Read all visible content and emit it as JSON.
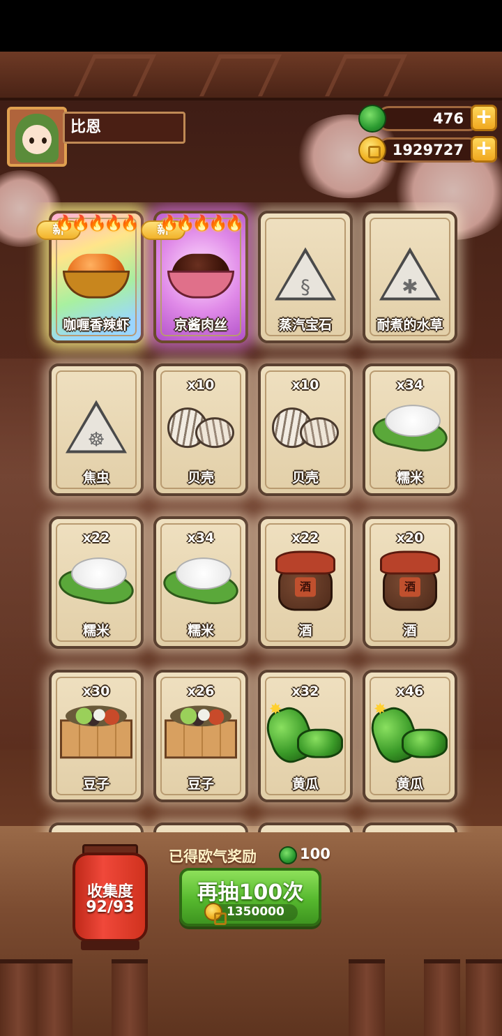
{
  "player": {
    "name": "比恩"
  },
  "resources": {
    "jade": "476",
    "coins": "1929727",
    "plus": "+"
  },
  "badge_new": "新",
  "cards": [
    {
      "label": "咖喱香辣虾",
      "count": "",
      "art": "dish-curry",
      "new": true,
      "rarity": "rainbow",
      "flames": "🔥🔥🔥🔥🔥"
    },
    {
      "label": "京酱肉丝",
      "count": "",
      "art": "dish-pork",
      "new": true,
      "rarity": "purple",
      "flames": "🔥🔥🔥🔥🔥"
    },
    {
      "label": "蒸汽宝石",
      "count": "",
      "art": "stone-steam",
      "new": false,
      "rarity": "normal"
    },
    {
      "label": "耐煮的水草",
      "count": "",
      "art": "stone-weed",
      "new": false,
      "rarity": "normal"
    },
    {
      "label": "焦虫",
      "count": "",
      "art": "stone-bug",
      "new": false,
      "rarity": "normal"
    },
    {
      "label": "贝壳",
      "count": "x10",
      "art": "shell",
      "new": false,
      "rarity": "normal"
    },
    {
      "label": "贝壳",
      "count": "x10",
      "art": "shell",
      "new": false,
      "rarity": "normal"
    },
    {
      "label": "糯米",
      "count": "x34",
      "art": "rice",
      "new": false,
      "rarity": "normal"
    },
    {
      "label": "糯米",
      "count": "x22",
      "art": "rice",
      "new": false,
      "rarity": "normal"
    },
    {
      "label": "糯米",
      "count": "x34",
      "art": "rice",
      "new": false,
      "rarity": "normal"
    },
    {
      "label": "酒",
      "count": "x22",
      "art": "jar",
      "new": false,
      "rarity": "normal"
    },
    {
      "label": "酒",
      "count": "x20",
      "art": "jar",
      "new": false,
      "rarity": "normal"
    },
    {
      "label": "豆子",
      "count": "x30",
      "art": "box",
      "new": false,
      "rarity": "normal"
    },
    {
      "label": "豆子",
      "count": "x26",
      "art": "box",
      "new": false,
      "rarity": "normal"
    },
    {
      "label": "黄瓜",
      "count": "x32",
      "art": "cucumber",
      "new": false,
      "rarity": "normal"
    },
    {
      "label": "黄瓜",
      "count": "x46",
      "art": "cucumber",
      "new": false,
      "rarity": "normal"
    }
  ],
  "jar_char": "酒",
  "collection": {
    "title": "收集度",
    "value": "92/93"
  },
  "reward": {
    "text": "已得欧气奖励",
    "value": "100"
  },
  "draw_button": {
    "label": "再抽100次",
    "cost": "1350000"
  }
}
